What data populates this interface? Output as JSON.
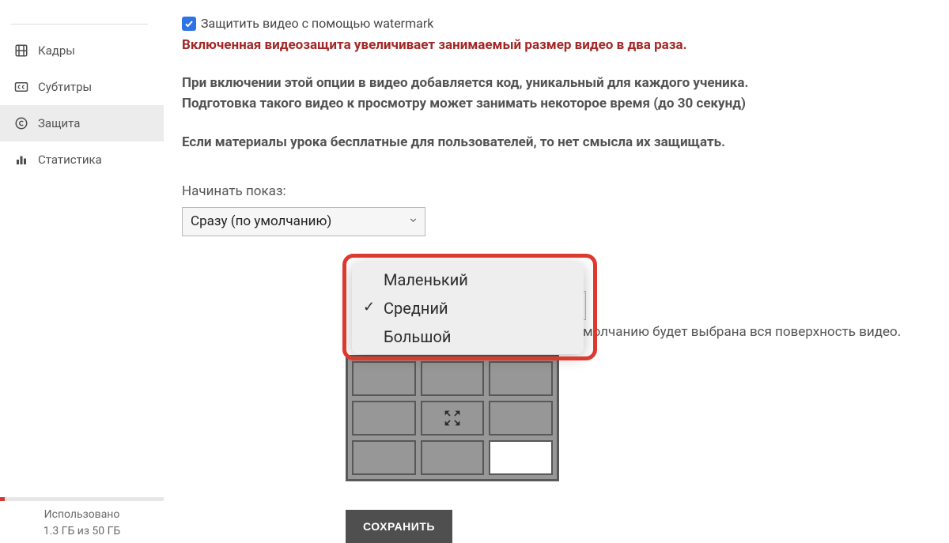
{
  "sidebar": {
    "items": [
      {
        "label": "Кадры",
        "icon": "film"
      },
      {
        "label": "Субтитры",
        "icon": "cc"
      },
      {
        "label": "Защита",
        "icon": "copyright"
      },
      {
        "label": "Статистика",
        "icon": "bars"
      }
    ],
    "footer": {
      "used_label": "Использовано",
      "used_value": "1.3 ГБ из 50 ГБ",
      "used_percent": 3
    }
  },
  "main": {
    "checkbox_label": "Защитить видео с помощью watermark",
    "warn": "Включенная видеозащита увеличивает занимаемый размер видео в два раза.",
    "desc1": "При включении этой опции в видео добавляется код, уникальный для каждого ученика.",
    "desc2": "Подготовка такого видео к просмотру может занимать некоторое время (до 30 секунд)",
    "desc3": "Если материалы урока бесплатные для пользователей, то нет смысла их защищать.",
    "start_label": "Начинать показ:",
    "start_value": "Сразу (по умолчанию)",
    "size_options": [
      "Маленький",
      "Средний",
      "Большой"
    ],
    "size_selected": "Средний",
    "area_hint": "о умолчанию будет выбрана вся поверхность видео.",
    "save_label": "СОХРАНИТЬ"
  }
}
